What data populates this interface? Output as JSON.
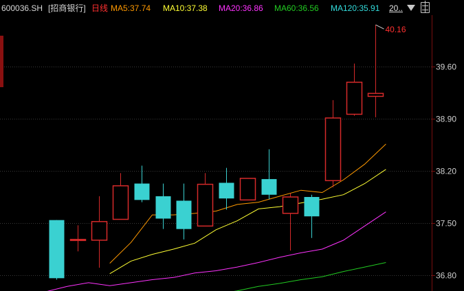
{
  "header": {
    "symbol": "600036.SH",
    "name": "[招商银行]",
    "period": "日线",
    "ma5": "MA5:37.74",
    "ma10": "MA10:37.38",
    "ma20": "MA20:36.86",
    "ma60": "MA60:36.56",
    "ma120": "MA120:35.91",
    "more": "20..",
    "colors": {
      "symbol": "#d8d8d8",
      "period": "#ff3030",
      "ma5": "#ff9900",
      "ma10": "#ffff33",
      "ma20": "#ff33ff",
      "ma60": "#22cc22",
      "ma120": "#33dddd"
    },
    "dropdown_icon": "triangle-down-icon",
    "settings_icon": "settings-icon"
  },
  "chart_data": {
    "type": "candlestick",
    "ylim": [
      36.62,
      40.35
    ],
    "y_ticks": [
      {
        "value": 36.8,
        "label": "36.80"
      },
      {
        "value": 37.5,
        "label": "37.50"
      },
      {
        "value": 38.2,
        "label": "38.20"
      },
      {
        "value": 38.9,
        "label": "38.90"
      },
      {
        "value": 39.6,
        "label": "39.60"
      }
    ],
    "max_annotation": {
      "value": 40.16,
      "label": "40.16"
    },
    "candles": [
      {
        "o": 37.54,
        "h": 37.54,
        "l": 36.74,
        "c": 36.76
      },
      {
        "o": 37.27,
        "h": 37.47,
        "l": 37.12,
        "c": 37.28
      },
      {
        "o": 37.27,
        "h": 37.86,
        "l": 36.9,
        "c": 37.52
      },
      {
        "o": 37.55,
        "h": 38.17,
        "l": 37.55,
        "c": 38.0
      },
      {
        "o": 38.03,
        "h": 38.27,
        "l": 37.78,
        "c": 37.81
      },
      {
        "o": 37.86,
        "h": 38.03,
        "l": 37.42,
        "c": 37.56
      },
      {
        "o": 37.8,
        "h": 38.03,
        "l": 37.28,
        "c": 37.42
      },
      {
        "o": 37.46,
        "h": 38.17,
        "l": 37.46,
        "c": 38.02
      },
      {
        "o": 38.04,
        "h": 38.24,
        "l": 37.68,
        "c": 37.83
      },
      {
        "o": 37.81,
        "h": 38.1,
        "l": 37.81,
        "c": 38.1
      },
      {
        "o": 38.09,
        "h": 38.49,
        "l": 37.82,
        "c": 37.88
      },
      {
        "o": 37.63,
        "h": 37.9,
        "l": 37.13,
        "c": 37.85
      },
      {
        "o": 37.85,
        "h": 37.88,
        "l": 37.3,
        "c": 37.59
      },
      {
        "o": 38.07,
        "h": 39.15,
        "l": 37.98,
        "c": 38.91
      },
      {
        "o": 38.96,
        "h": 39.64,
        "l": 38.94,
        "c": 39.39
      },
      {
        "o": 39.2,
        "h": 40.16,
        "l": 38.92,
        "c": 39.24
      }
    ],
    "series": [
      {
        "name": "MA5",
        "color": "#ff9900",
        "values": [
          null,
          null,
          null,
          36.96,
          37.24,
          37.61,
          37.61,
          37.63,
          37.66,
          37.75,
          37.78,
          37.86,
          37.94,
          37.91,
          38.08,
          38.29,
          38.56
        ]
      },
      {
        "name": "MA10",
        "color": "#ffff33",
        "values": [
          null,
          null,
          null,
          36.82,
          36.99,
          37.08,
          37.15,
          37.23,
          37.41,
          37.53,
          37.69,
          37.72,
          37.77,
          37.82,
          37.88,
          38.03,
          38.22
        ]
      },
      {
        "name": "MA20",
        "color": "#ff33ff",
        "values": [
          36.58,
          36.65,
          36.7,
          36.66,
          36.7,
          36.74,
          36.77,
          36.83,
          36.86,
          36.91,
          36.97,
          37.04,
          37.1,
          37.15,
          37.27,
          37.46,
          37.65
        ]
      },
      {
        "name": "MA60",
        "color": "#22cc22",
        "values": [
          null,
          null,
          null,
          null,
          null,
          null,
          null,
          null,
          36.55,
          36.59,
          36.65,
          36.69,
          36.74,
          36.78,
          36.85,
          36.91,
          36.97
        ]
      }
    ]
  }
}
